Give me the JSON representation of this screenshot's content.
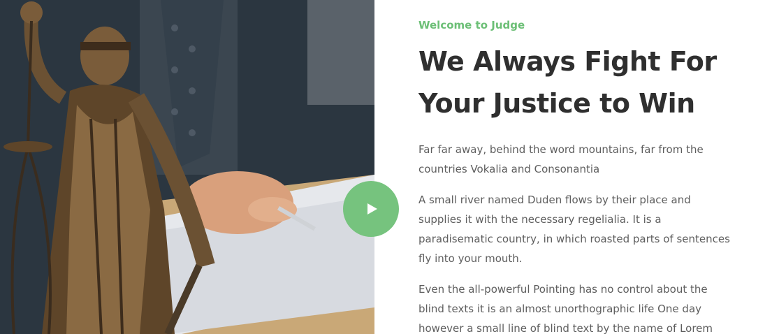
{
  "eyebrow": "Welcome to Judge",
  "headline": "We Always Fight For Your Justice to Win",
  "paragraphs": [
    "Far far away, behind the word mountains, far from the countries Vokalia and Consonantia",
    "A small river named Duden flows by their place and supplies it with the necessary regelialia. It is a paradisematic country, in which roasted parts of sentences fly into your mouth.",
    "Even the all-powerful Pointing has no control about the blind texts it is an almost unorthographic life One day however a small line of blind text by the name of Lorem"
  ],
  "colors": {
    "accent": "#76c37e",
    "heading": "#2f2f2f",
    "body": "#5e5e5e"
  },
  "icons": {
    "play": "play-icon"
  }
}
